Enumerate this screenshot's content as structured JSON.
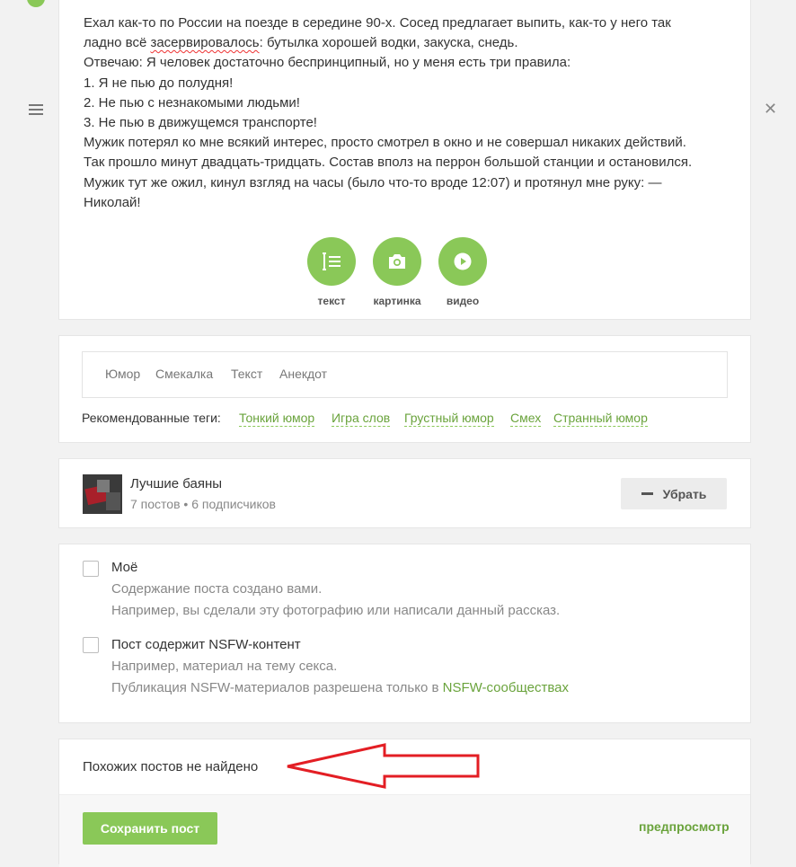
{
  "post": {
    "lines": [
      "Ехал как-то по России на поезде в середине 90-х. Сосед предлагает выпить, как-то у него так",
      "ладно всё ",
      "засервировалось",
      ": бутылка хорошей водки, закуска, снедь.",
      "Отвечаю: Я человек достаточно беспринципный, но у меня есть три правила:",
      "1. Я не пью до полудня!",
      "2. Не пью с незнакомыми людьми!",
      "3. Не пью в движущемся транспорте!",
      "Мужик потерял ко мне всякий интерес, просто смотрел в окно и не совершал никаких действий.",
      "Так прошло минут двадцать-тридцать. Состав вполз на перрон большой станции и остановился.",
      "Мужик тут же ожил, кинул взгляд на часы (было что-то вроде 12:07) и протянул мне руку: —",
      "Николай!"
    ]
  },
  "tools": [
    {
      "label": "текст",
      "icon": "text-cursor-icon"
    },
    {
      "label": "картинка",
      "icon": "camera-icon"
    },
    {
      "label": "видео",
      "icon": "play-icon"
    }
  ],
  "tags": {
    "current": [
      "Юмор",
      "Смекалка",
      "Текст",
      "Анекдот"
    ],
    "recommended_label": "Рекомендованные теги:",
    "recommended": [
      "Тонкий юмор",
      "Игра слов",
      "Грустный юмор",
      "Смех",
      "Странный юмор"
    ]
  },
  "community": {
    "name": "Лучшие баяны",
    "posts": "7 постов",
    "separator": "•",
    "subscribers": "6 подписчиков",
    "remove_label": "Убрать"
  },
  "options": {
    "mine": {
      "title": "Моё",
      "desc1": "Содержание поста создано вами.",
      "desc2": "Например, вы сделали эту фотографию или написали данный рассказ."
    },
    "nsfw": {
      "title": "Пост содержит NSFW-контент",
      "desc1": "Например, материал на тему секса.",
      "desc2_prefix": "Публикация NSFW-материалов разрешена только в ",
      "desc2_link": "NSFW-сообществах"
    }
  },
  "similar": "Похожих постов не найдено",
  "actions": {
    "save": "Сохранить пост",
    "preview": "предпросмотр"
  },
  "colors": {
    "accent": "#8ac858",
    "link": "#6aa33c",
    "annotation": "#e31e24"
  }
}
